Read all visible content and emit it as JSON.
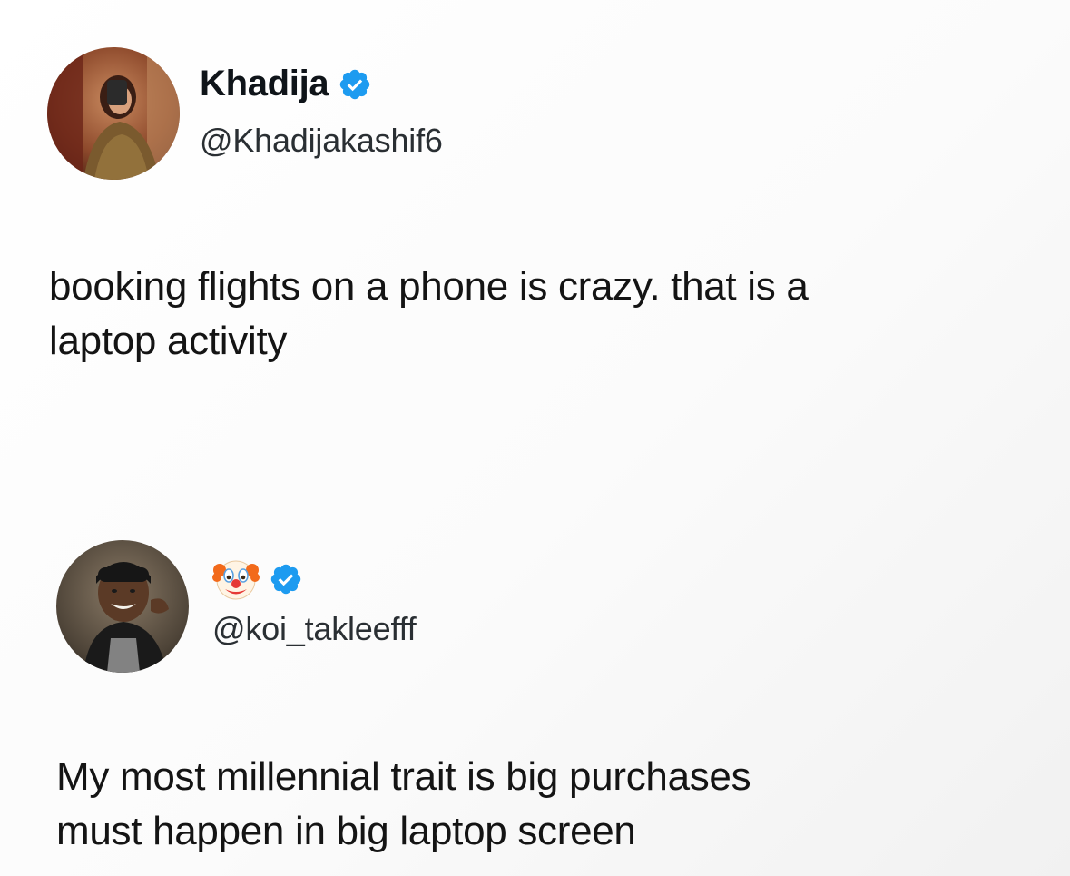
{
  "colors": {
    "verified_badge": "#1d9bf0",
    "text": "#141414",
    "handle": "#2a2f33"
  },
  "tweets": [
    {
      "display_name": "Khadija",
      "handle": "@Khadijakashif6",
      "verified": true,
      "badge_icon": "verified-badge-icon",
      "text_lines": [
        "booking flights on a phone is crazy. that is a",
        "laptop activity"
      ]
    },
    {
      "display_name_icon": "clown-face-emoji-icon",
      "handle": "@koi_takleefff",
      "verified": true,
      "badge_icon": "verified-badge-icon",
      "text_lines": [
        "My most millennial trait is big purchases",
        "must happen in big laptop screen"
      ]
    }
  ]
}
